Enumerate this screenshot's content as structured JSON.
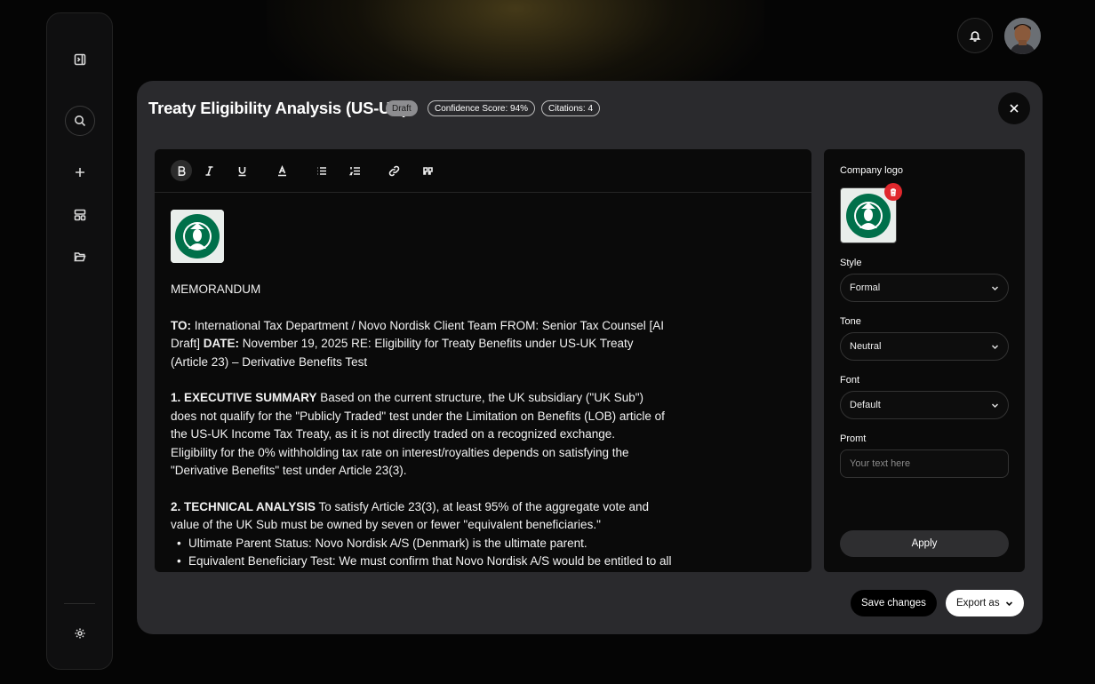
{
  "modal": {
    "title": "Treaty Eligibility Analysis (US-UK)",
    "badges": {
      "status": "Draft",
      "confidence": "Confidence Score: 94%",
      "citations": "Citations: 4"
    }
  },
  "toolbar": {
    "items": [
      "bold-icon",
      "italic-icon",
      "underline-icon",
      "text-color-icon",
      "bullet-list-icon",
      "numbered-list-icon",
      "link-icon",
      "quote-icon"
    ]
  },
  "document": {
    "heading": "MEMORANDUM",
    "header_to_label": "TO:",
    "header_to_text": " International Tax Department / Novo Nordisk Client Team FROM: Senior Tax Counsel [AI Draft] ",
    "header_date_label": "DATE:",
    "header_date_text": " November 19, 2025 RE: Eligibility for Treaty Benefits under US-UK Treaty (Article 23) – Derivative Benefits Test",
    "s1_title": "1. EXECUTIVE SUMMARY",
    "s1_text": " Based on the current structure, the UK subsidiary (\"UK Sub\") does not qualify for the \"Publicly Traded\" test under the Limitation on Benefits (LOB) article of the US-UK Income Tax Treaty, as it is not directly traded on a recognized exchange.",
    "s1_text2": "Eligibility for the 0% withholding tax rate on interest/royalties depends on satisfying the \"Derivative Benefits\" test under Article 23(3).",
    "s2_title": "2. TECHNICAL ANALYSIS",
    "s2_text": " To satisfy Article 23(3), at least 95% of the aggregate vote and value of the UK Sub must be owned by seven or fewer \"equivalent beneficiaries.\"",
    "bullets": [
      "Ultimate Parent Status: Novo Nordisk A/S (Denmark) is the ultimate parent.",
      "Equivalent Beneficiary Test: We must confirm that Novo Nordisk A/S would be entitled to all"
    ]
  },
  "panel": {
    "logo_label": "Company logo",
    "style_label": "Style",
    "style_value": "Formal",
    "tone_label": "Tone",
    "tone_value": "Neutral",
    "font_label": "Font",
    "font_value": "Default",
    "prompt_label": "Promt",
    "prompt_placeholder": "Your text here",
    "apply_label": "Apply"
  },
  "footer": {
    "save_label": "Save changes",
    "export_label": "Export as"
  },
  "colors": {
    "modal_bg": "#2a2a2d",
    "editor_bg": "#0a0a0a",
    "delete_red": "#e0282d",
    "draft_badge": "#8d8d90"
  }
}
